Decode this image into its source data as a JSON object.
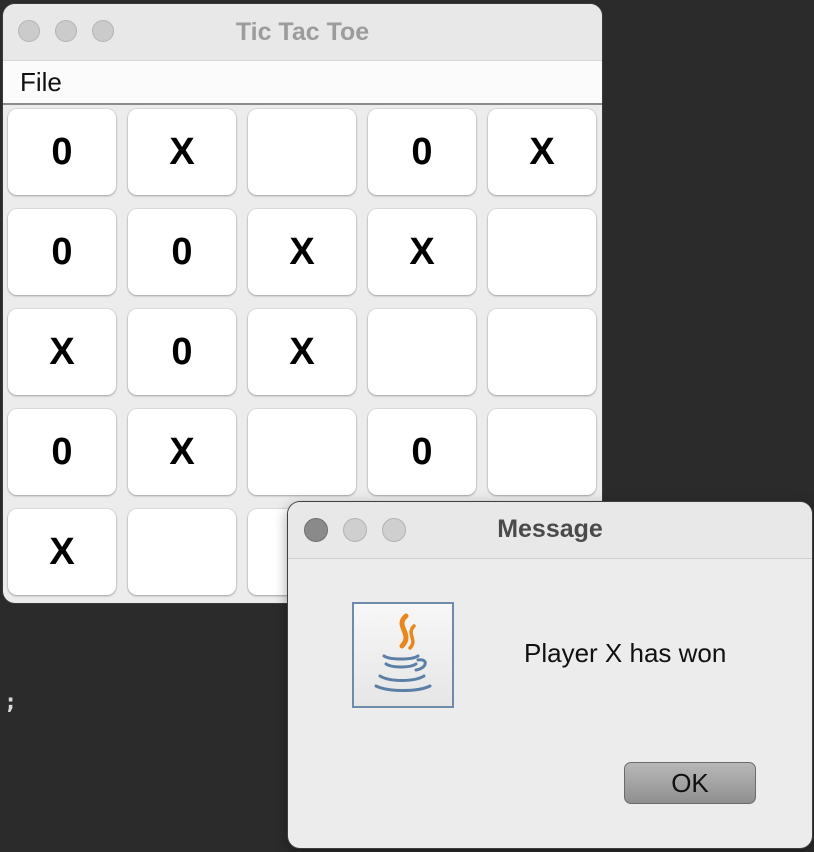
{
  "window": {
    "title": "Tic Tac Toe"
  },
  "menubar": {
    "file_label": "File"
  },
  "board": {
    "rows": [
      [
        "0",
        "X",
        "",
        "0",
        "X"
      ],
      [
        "0",
        "0",
        "X",
        "X",
        ""
      ],
      [
        "X",
        "0",
        "X",
        "",
        ""
      ],
      [
        "0",
        "X",
        "",
        "0",
        ""
      ],
      [
        "X",
        "",
        "",
        "",
        ""
      ]
    ]
  },
  "dialog": {
    "title": "Message",
    "message": "Player X has won",
    "ok_label": "OK",
    "icon": "java-cup-icon"
  },
  "background": {
    "text": ";"
  }
}
